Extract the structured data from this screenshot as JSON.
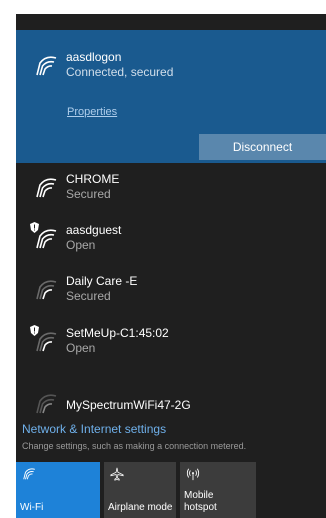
{
  "connected": {
    "ssid": "aasdlogon",
    "status": "Connected, secured",
    "properties_label": "Properties",
    "disconnect_label": "Disconnect"
  },
  "networks": [
    {
      "ssid": "CHROME",
      "status": "Secured",
      "warning": false
    },
    {
      "ssid": "aasdguest",
      "status": "Open",
      "warning": true
    },
    {
      "ssid": "Daily Care -E",
      "status": "Secured",
      "warning": false
    },
    {
      "ssid": "SetMeUp-C1:45:02",
      "status": "Open",
      "warning": true
    },
    {
      "ssid": "MySpectrumWiFi47-2G",
      "status": "",
      "warning": false
    }
  ],
  "settings": {
    "title": "Network & Internet settings",
    "subtitle": "Change settings, such as making a connection metered."
  },
  "quick_actions": [
    {
      "label": "Wi-Fi",
      "icon": "wifi-icon",
      "active": true
    },
    {
      "label": "Airplane mode",
      "icon": "airplane-icon",
      "active": false
    },
    {
      "label": "Mobile hotspot",
      "icon": "hotspot-icon",
      "active": false
    }
  ],
  "colors": {
    "accent": "#1e82d8",
    "connected_bg": "#1a5a8f",
    "flyout_bg": "#1f1f1f",
    "link": "#6fb0ea"
  }
}
